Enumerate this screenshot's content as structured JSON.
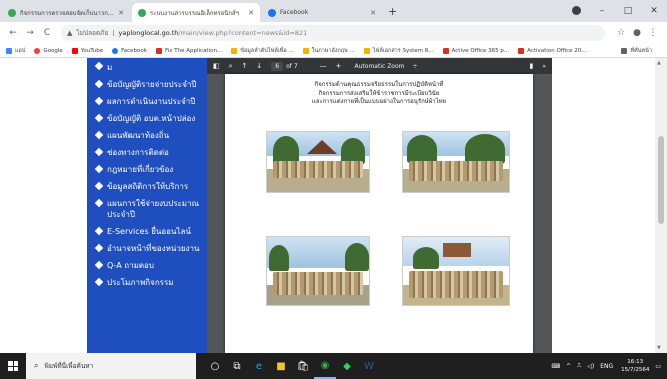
{
  "browser": {
    "tabs": [
      {
        "title": "กิจกรรมการตรวจสอบจัดเก็บนาวการ",
        "color": "#34a853",
        "active": false
      },
      {
        "title": "ระบบงานสารบรรณอิเล็กทรอนิกส์ฯ",
        "color": "#34a853",
        "active": true
      },
      {
        "title": "Facebook",
        "color": "#1877f2",
        "active": false
      }
    ],
    "new_tab": "+",
    "window_controls": [
      "–",
      "□",
      "✕"
    ],
    "nav": {
      "back": "←",
      "forward": "→",
      "reload": "C"
    },
    "address": {
      "security_icon": "▲",
      "security_text": "ไม่ปลอดภัย",
      "host": "yaplonglocal.go.th",
      "path": "/main/view.php?content=news&id=821"
    },
    "toolbar_right": [
      "☆",
      "●",
      "⋮"
    ]
  },
  "bookmarks": {
    "items": [
      {
        "label": "แอป",
        "color": "#4285f4"
      },
      {
        "label": "Google",
        "color": "#ea4335"
      },
      {
        "label": "YouTube",
        "color": "#ff0000"
      },
      {
        "label": "Facebook",
        "color": "#1877f2"
      },
      {
        "label": "Fix The Application...",
        "color": "#d93025"
      },
      {
        "label": "ข้อมูลลำดับไฟล์เพื่อ ...",
        "color": "#f4b400"
      },
      {
        "label": "ในภาษาอังกฤษ ...",
        "color": "#f4b400"
      },
      {
        "label": "ไฟล์เอกสาร System R...",
        "color": "#f4b400"
      },
      {
        "label": "Active Office 365 p...",
        "color": "#d93025"
      },
      {
        "label": "Activation Office 20...",
        "color": "#d93025"
      }
    ],
    "reading_list": "ที่คั่นหน้า"
  },
  "sidebar": {
    "items": [
      "ม",
      "ข้อบัญญัติรายจ่ายประจำปี",
      "ผลการดำเนินงานประจำปี",
      "ข้อบัญญัติ อบต.หน้าปล่อง",
      "แผนพัฒนาท้องถิ่น",
      "ช่องทางการติดต่อ",
      "กฎหมายที่เกี่ยวข้อง",
      "ข้อมูลสถิติการให้บริการ",
      "แผนการใช้จ่ายงบประมาณประจำปี",
      "E-Services ยื่นออนไลน์",
      "อำนาจหน้าที่ของหน่วยงาน",
      "Q-A ถามตอบ",
      "ประโมภาพกิจกรรม"
    ]
  },
  "pdf": {
    "toolbar": {
      "sidebar_toggle": "◧",
      "search": "⌕",
      "prev": "↑",
      "next": "↓",
      "page_number": "6",
      "page_total": "of 7",
      "zoom_out": "—",
      "zoom_in": "+",
      "zoom": "Automatic Zoom",
      "zoom_caret": "÷",
      "bookmark": "▮",
      "more": "»"
    },
    "heading": [
      "กิจกรรมด้านคุณธรรมจริยธรรมในการปฏิบัติหน้าที่",
      "กิจกรรมการส่งเสริมให้ข้าราชการมีระเบียบวินัย",
      "และการแต่งกายที่เป็นแบบอย่างในการอนุรักษ์ผ้าไทย"
    ]
  },
  "taskbar": {
    "search_placeholder": "พิมพ์ที่นี่เพื่อค้นหา",
    "search_icon": "⌕",
    "apps": [
      {
        "icon": "○",
        "color": "#ffffff"
      },
      {
        "icon": "⧉",
        "color": "#ffffff"
      },
      {
        "icon": "e",
        "color": "#2aa1e3"
      },
      {
        "icon": "■",
        "color": "#f4c430"
      },
      {
        "icon": "🛍",
        "color": "#ffffff"
      },
      {
        "icon": "◉",
        "color": "#34a853"
      },
      {
        "icon": "◆",
        "color": "#25d366"
      },
      {
        "icon": "W",
        "color": "#2b579a"
      }
    ],
    "tray": {
      "keyboard": "⌨",
      "caret": "^",
      "network": "⎍",
      "volume": "◁)",
      "lang": "ENG",
      "time": "16:13",
      "date": "15/7/2564",
      "notif": "▭"
    }
  }
}
